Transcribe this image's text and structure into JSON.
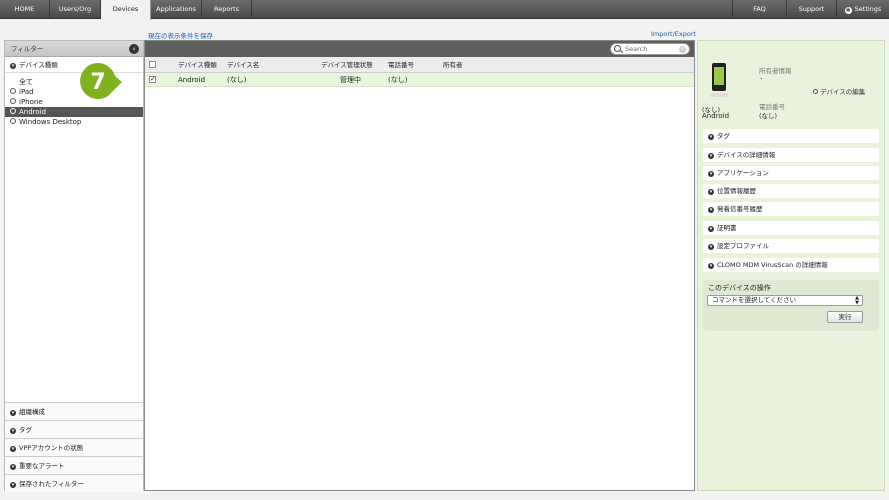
{
  "nav": {
    "tabs": [
      "HOME",
      "Users/Org",
      "Devices",
      "Applications",
      "Reports"
    ],
    "right": [
      "FAQ",
      "Support",
      "Settings"
    ]
  },
  "links": {
    "save_filter": "現在の表示条件を保存",
    "import_export": "Import/Export"
  },
  "sidebar": {
    "header": "フィルター",
    "section": "デバイス種類",
    "items": [
      "全て",
      "iPad",
      "iPhone",
      "Android",
      "Windows Desktop"
    ],
    "bottom": [
      "組織構成",
      "タグ",
      "VPPアカウントの状態",
      "重要なアラート",
      "保存されたフィルター"
    ]
  },
  "table": {
    "search_placeholder": "Search",
    "headers": [
      "デバイス種類",
      "デバイス名",
      "デバイス管理状態",
      "電話番号",
      "所有者"
    ],
    "rows": [
      {
        "type": "Android",
        "name": "(なし)",
        "status": "管理中",
        "phone": "(なし)",
        "owner": ""
      }
    ]
  },
  "callout": {
    "number": "7",
    "color": "#7fb21e"
  },
  "detail": {
    "device_name": "(なし)",
    "device_type": "Android",
    "owner_label": "所有者情報",
    "owner_value": "-",
    "edit_link": "デバイスの編集",
    "phone_label": "電話番号",
    "phone_value": "(なし)",
    "sections": [
      "タグ",
      "デバイスの詳細情報",
      "アプリケーション",
      "位置情報履歴",
      "発着信番号履歴",
      "証明書",
      "設定プロファイル",
      "CLOMO MDM VirusScan の詳細情報"
    ],
    "ops_title": "このデバイスの操作",
    "command_select": "コマンドを選択してください",
    "run_button": "実行"
  }
}
